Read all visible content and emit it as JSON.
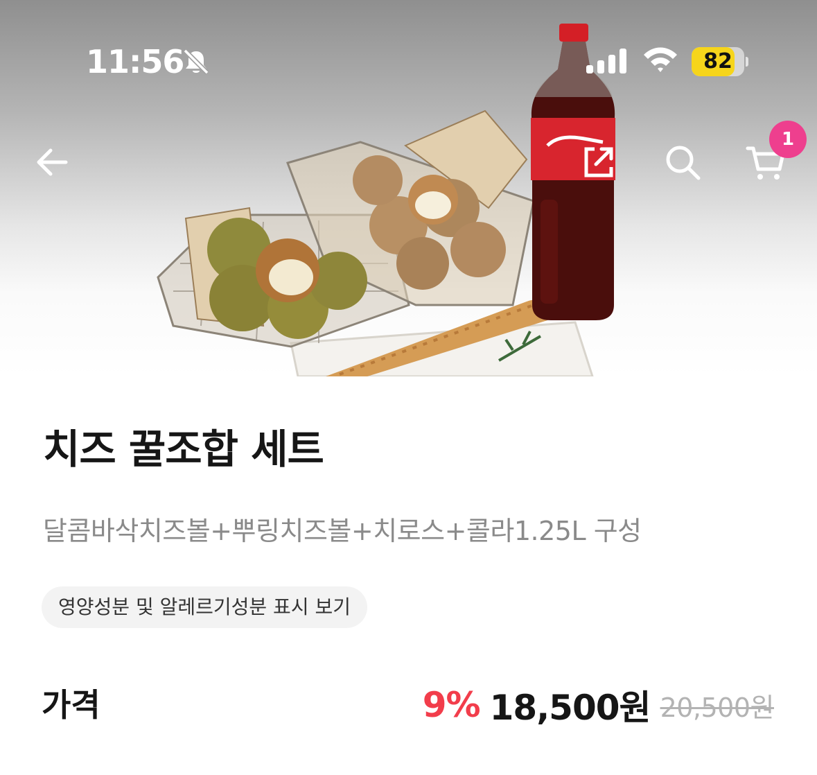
{
  "status_bar": {
    "time": "11:56",
    "battery": "82",
    "battery_level_percent": 82,
    "icons": [
      "bell-slash-icon",
      "cellular-signal-icon",
      "wifi-icon",
      "battery-icon"
    ],
    "battery_color": "#f6d51b"
  },
  "nav": {
    "icons": [
      "arrow-left-icon",
      "share-icon",
      "search-icon",
      "cart-icon"
    ],
    "cart_count": "1",
    "badge_color": "#ee3f8e"
  },
  "product": {
    "title": "치즈 꿀조합 세트",
    "description": "달콤바삭치즈볼+뿌링치즈볼+치로스+콜라1.25L 구성",
    "nutrition_button": "영양성분 및 알레르기성분 표시 보기",
    "price_label": "가격",
    "discount": "9%",
    "price": "18,500원",
    "original_price": "20,500원",
    "discount_color": "#f23d4b"
  }
}
